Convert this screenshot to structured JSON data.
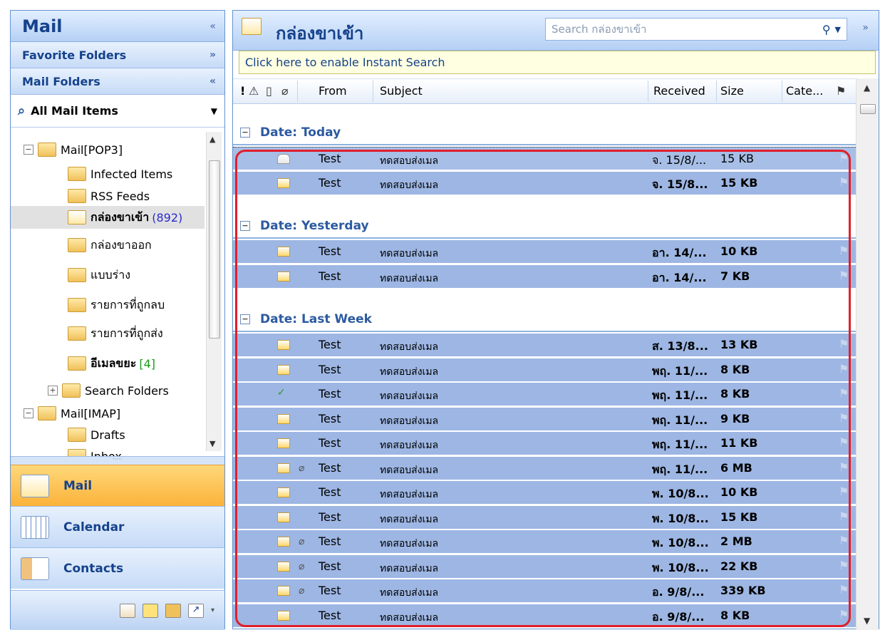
{
  "nav": {
    "title": "Mail",
    "favorites_label": "Favorite Folders",
    "mail_folders_label": "Mail Folders",
    "all_mail_items": "All Mail Items",
    "tree": [
      {
        "label": "Mail[POP3]",
        "count": "",
        "indent": 0,
        "expander": "−",
        "selected": false
      },
      {
        "label": "Infected Items",
        "count": "",
        "indent": 1,
        "expander": "",
        "selected": false
      },
      {
        "label": "RSS Feeds",
        "count": "",
        "indent": 1,
        "expander": "",
        "selected": false
      },
      {
        "label": "กล่องขาเข้า",
        "count": "(892)",
        "indent": 1,
        "expander": "",
        "selected": true
      },
      {
        "label": "กล่องขาออก",
        "count": "",
        "indent": 1,
        "expander": "",
        "selected": false
      },
      {
        "label": "แบบร่าง",
        "count": "",
        "indent": 1,
        "expander": "",
        "selected": false
      },
      {
        "label": "รายการที่ถูกลบ",
        "count": "",
        "indent": 1,
        "expander": "",
        "selected": false
      },
      {
        "label": "รายการที่ถูกส่ง",
        "count": "",
        "indent": 1,
        "expander": "",
        "selected": false
      },
      {
        "label": "อีเมลขยะ",
        "count": "[4]",
        "indent": 1,
        "expander": "",
        "selected": false
      },
      {
        "label": "Search Folders",
        "count": "",
        "indent": 1,
        "expander": "+",
        "selected": false
      },
      {
        "label": "Mail[IMAP]",
        "count": "",
        "indent": 0,
        "expander": "−",
        "selected": false
      },
      {
        "label": "Drafts",
        "count": "",
        "indent": 1,
        "expander": "",
        "selected": false
      },
      {
        "label": "Inbox",
        "count": "",
        "indent": 1,
        "expander": "",
        "selected": false
      }
    ],
    "buttons": {
      "mail": "Mail",
      "calendar": "Calendar",
      "contacts": "Contacts"
    }
  },
  "main": {
    "title": "กล่องขาเข้า",
    "search_placeholder": "Search กล่องขาเข้า",
    "instant_search": "Click here to enable Instant Search",
    "columns": {
      "importance": "!",
      "from": "From",
      "subject": "Subject",
      "received": "Received",
      "size": "Size",
      "categories": "Cate..."
    },
    "groups": [
      {
        "label": "Date: Today",
        "rows": [
          {
            "from": "Test",
            "subject": "ทดสอบส่งเมล",
            "received": "จ. 15/8/...",
            "size": "15 KB",
            "icon": "read",
            "attach": false
          },
          {
            "from": "Test",
            "subject": "ทดสอบส่งเมล",
            "received": "จ. 15/8...",
            "size": "15 KB",
            "icon": "unread",
            "attach": false
          }
        ]
      },
      {
        "label": "Date: Yesterday",
        "rows": [
          {
            "from": "Test",
            "subject": "ทดสอบส่งเมล",
            "received": "อา. 14/...",
            "size": "10 KB",
            "icon": "unread",
            "attach": false
          },
          {
            "from": "Test",
            "subject": "ทดสอบส่งเมล",
            "received": "อา. 14/...",
            "size": "7 KB",
            "icon": "unread",
            "attach": false
          }
        ]
      },
      {
        "label": "Date: Last Week",
        "rows": [
          {
            "from": "Test",
            "subject": "ทดสอบส่งเมล",
            "received": "ส. 13/8...",
            "size": "13 KB",
            "icon": "unread",
            "attach": false
          },
          {
            "from": "Test",
            "subject": "ทดสอบส่งเมล",
            "received": "พฤ. 11/...",
            "size": "8 KB",
            "icon": "unread",
            "attach": false
          },
          {
            "from": "Test",
            "subject": "ทดสอบส่งเมล",
            "received": "พฤ. 11/...",
            "size": "8 KB",
            "icon": "ok",
            "attach": false
          },
          {
            "from": "Test",
            "subject": "ทดสอบส่งเมล",
            "received": "พฤ. 11/...",
            "size": "9 KB",
            "icon": "unread",
            "attach": false
          },
          {
            "from": "Test",
            "subject": "ทดสอบส่งเมล",
            "received": "พฤ. 11/...",
            "size": "11 KB",
            "icon": "unread",
            "attach": false
          },
          {
            "from": "Test",
            "subject": "ทดสอบส่งเมล",
            "received": "พฤ. 11/...",
            "size": "6 MB",
            "icon": "unread",
            "attach": true
          },
          {
            "from": "Test",
            "subject": "ทดสอบส่งเมล",
            "received": "พ. 10/8...",
            "size": "10 KB",
            "icon": "unread",
            "attach": false
          },
          {
            "from": "Test",
            "subject": "ทดสอบส่งเมล",
            "received": "พ. 10/8...",
            "size": "15 KB",
            "icon": "unread",
            "attach": false
          },
          {
            "from": "Test",
            "subject": "ทดสอบส่งเมล",
            "received": "พ. 10/8...",
            "size": "2 MB",
            "icon": "unread",
            "attach": true
          },
          {
            "from": "Test",
            "subject": "ทดสอบส่งเมล",
            "received": "พ. 10/8...",
            "size": "22 KB",
            "icon": "unread",
            "attach": true
          },
          {
            "from": "Test",
            "subject": "ทดสอบส่งเมล",
            "received": "อ. 9/8/...",
            "size": "339 KB",
            "icon": "unread",
            "attach": true
          },
          {
            "from": "Test",
            "subject": "ทดสอบส่งเมล",
            "received": "อ. 9/8/...",
            "size": "8 KB",
            "icon": "unread",
            "attach": false
          }
        ]
      }
    ]
  },
  "colors": {
    "selection": "#9db6e3",
    "highlight_box": "#e01f2a",
    "accent": "#15428b"
  }
}
